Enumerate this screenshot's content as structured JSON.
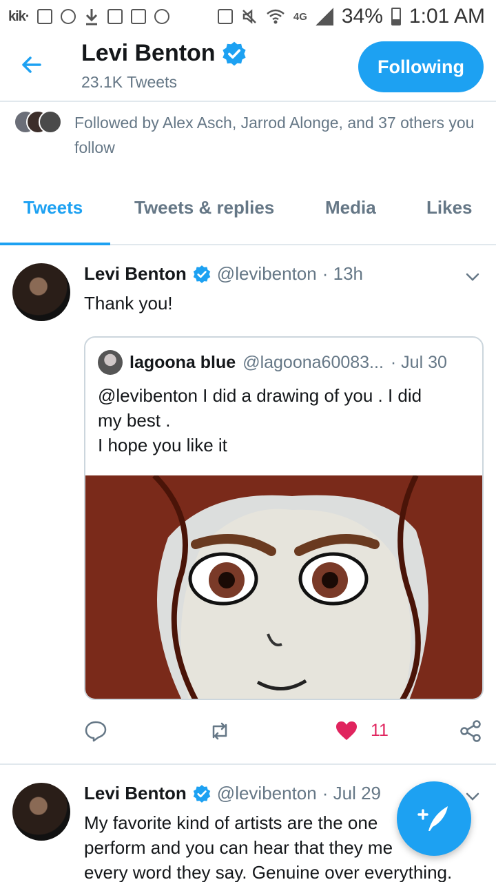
{
  "status_bar": {
    "battery": "34%",
    "time": "1:01 AM",
    "app_label": "kik·",
    "network": "4G"
  },
  "header": {
    "name": "Levi Benton",
    "tweet_count": "23.1K Tweets",
    "follow_label": "Following"
  },
  "followed_by": {
    "text": "Followed by Alex Asch, Jarrod Alonge, and 37 others you follow"
  },
  "tabs": [
    {
      "label": "Tweets",
      "active": true
    },
    {
      "label": "Tweets & replies",
      "active": false
    },
    {
      "label": "Media",
      "active": false
    },
    {
      "label": "Likes",
      "active": false
    }
  ],
  "tweets": [
    {
      "name": "Levi Benton",
      "handle": "@levibenton",
      "time": "· 13h",
      "text": "Thank you!",
      "quote": {
        "name": "lagoona blue",
        "handle": "@lagoona60083...",
        "time": "· Jul 30",
        "text_lines": [
          "@levibenton  I did a drawing of you . I did",
          "my best .",
          "I hope you like it"
        ]
      },
      "likes": "11"
    },
    {
      "name": "Levi Benton",
      "handle": "@levibenton",
      "time": "· Jul 29",
      "text_lines": [
        "My favorite kind of artists are the one",
        "perform and you can hear that they me",
        "every word they say. Genuine over everything."
      ]
    }
  ],
  "colors": {
    "accent": "#1da1f2",
    "like": "#e0245e",
    "muted": "#657786"
  }
}
